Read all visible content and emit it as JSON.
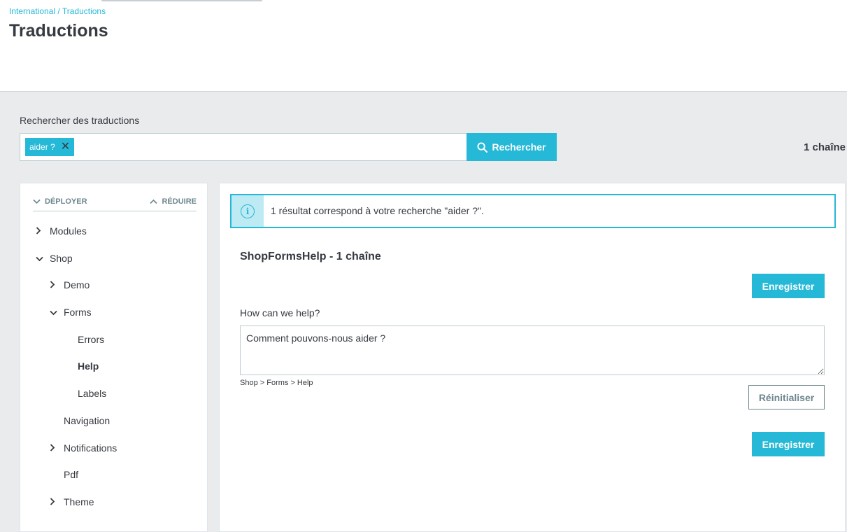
{
  "breadcrumb": {
    "parent": "International",
    "separator": " / ",
    "current": "Traductions"
  },
  "page": {
    "title": "Traductions"
  },
  "search": {
    "label": "Rechercher des traductions",
    "tag": "aider ?",
    "tag_remove": "✕",
    "button_label": "Rechercher",
    "search_icon": "search-icon"
  },
  "summary": {
    "count_label": "1 chaîne"
  },
  "tree": {
    "expand_label": "DÉPLOYER",
    "collapse_label": "RÉDUIRE",
    "items": [
      {
        "label": "Modules",
        "state": "collapsed"
      },
      {
        "label": "Shop",
        "state": "expanded"
      },
      {
        "label": "Demo",
        "state": "collapsed"
      },
      {
        "label": "Forms",
        "state": "expanded"
      },
      {
        "label": "Errors",
        "state": "leaf"
      },
      {
        "label": "Help",
        "state": "selected"
      },
      {
        "label": "Labels",
        "state": "leaf"
      },
      {
        "label": "Navigation",
        "state": "leaf"
      },
      {
        "label": "Notifications",
        "state": "collapsed"
      },
      {
        "label": "Pdf",
        "state": "leaf"
      },
      {
        "label": "Theme",
        "state": "collapsed"
      }
    ]
  },
  "results": {
    "alert_text": "1 résultat correspond à votre recherche \"aider ?\".",
    "domain_title": "ShopFormsHelp - 1 chaîne",
    "save_label": "Enregistrer",
    "source_string": "How can we help?",
    "translation": "Comment pouvons-nous aider ?",
    "path": "Shop > Forms > Help",
    "reset_label": "Réinitialiser"
  },
  "colors": {
    "accent": "#25b9d7",
    "background": "#eaebec",
    "text": "#363a41"
  }
}
